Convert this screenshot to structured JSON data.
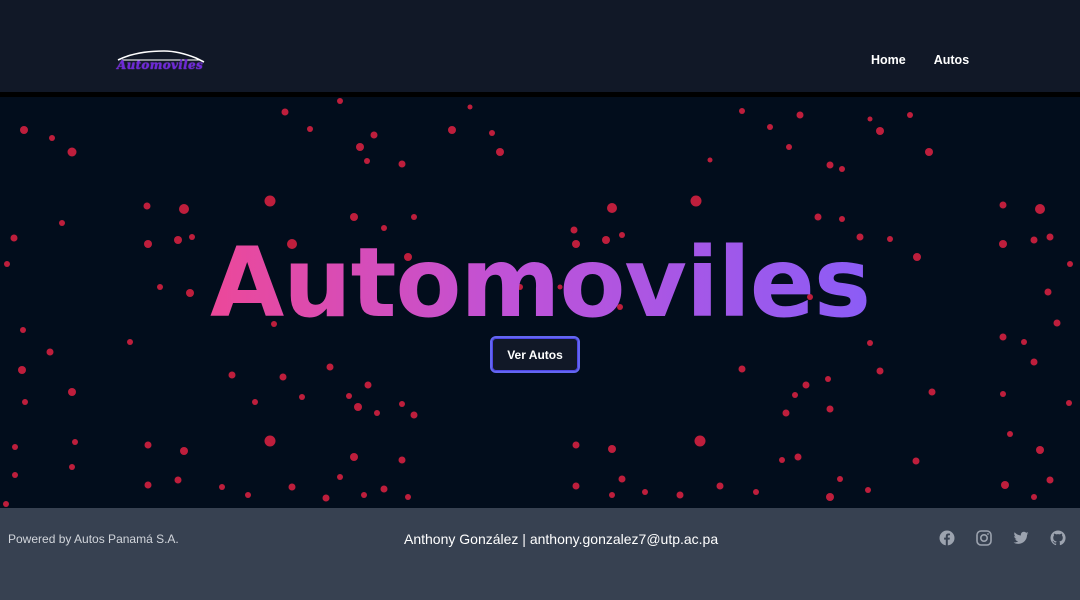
{
  "navbar": {
    "logo_text": "Automoviles",
    "links": [
      "Home",
      "Autos"
    ]
  },
  "hero": {
    "title": "Automoviles",
    "button_label": "Ver Autos"
  },
  "footer": {
    "powered_by": "Powered by Autos Panamá S.A.",
    "author": "Anthony González | anthony.gonzalez7@utp.ac.pa",
    "social_icons": [
      "facebook-icon",
      "instagram-icon",
      "twitter-icon",
      "github-icon"
    ]
  },
  "colors": {
    "navbar_bg": "#111827",
    "hero_bg": "#020d1c",
    "footer_bg": "#374151",
    "particle": "#be1e3c",
    "gradient_start": "#ec4899",
    "gradient_end": "#8b5cf6",
    "button_border": "#6366f1"
  }
}
